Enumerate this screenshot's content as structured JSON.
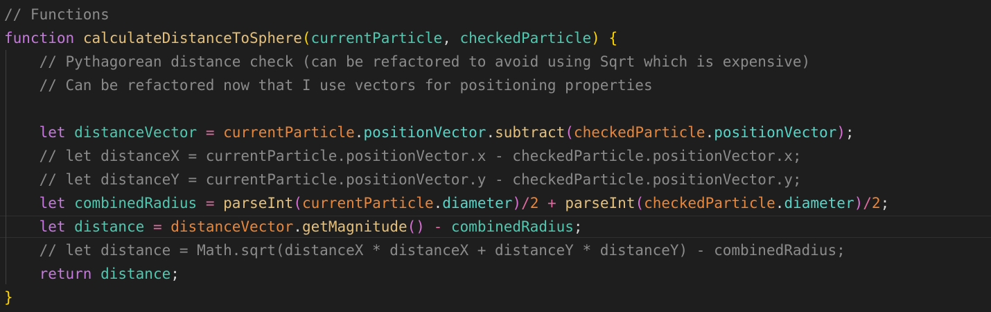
{
  "editor": {
    "lines": [
      {
        "tokens": [
          {
            "t": "// Functions",
            "c": "comment"
          }
        ]
      },
      {
        "tokens": [
          {
            "t": "function",
            "c": "kw"
          },
          {
            "t": " ",
            "c": "op"
          },
          {
            "t": "calculateDistanceToSphere",
            "c": "fn-name"
          },
          {
            "t": "(",
            "c": "paren-y"
          },
          {
            "t": "currentParticle",
            "c": "var"
          },
          {
            "t": ", ",
            "c": "op"
          },
          {
            "t": "checkedParticle",
            "c": "var"
          },
          {
            "t": ")",
            "c": "paren-y"
          },
          {
            "t": " ",
            "c": "op"
          },
          {
            "t": "{",
            "c": "brace"
          }
        ]
      },
      {
        "tokens": [
          {
            "t": "    // Pythagorean distance check (can be refactored to avoid using Sqrt which is expensive)",
            "c": "comment"
          }
        ]
      },
      {
        "tokens": [
          {
            "t": "    // Can be refactored now that I use vectors for positioning properties",
            "c": "comment"
          }
        ]
      },
      {
        "tokens": [
          {
            "t": "",
            "c": "op"
          }
        ]
      },
      {
        "tokens": [
          {
            "t": "    ",
            "c": "op"
          },
          {
            "t": "let",
            "c": "kw"
          },
          {
            "t": " ",
            "c": "op"
          },
          {
            "t": "distanceVector",
            "c": "var"
          },
          {
            "t": " = ",
            "c": "opm"
          },
          {
            "t": "currentParticle",
            "c": "obj"
          },
          {
            "t": ".",
            "c": "op"
          },
          {
            "t": "positionVector",
            "c": "prop"
          },
          {
            "t": ".",
            "c": "op"
          },
          {
            "t": "subtract",
            "c": "fn"
          },
          {
            "t": "(",
            "c": "paren-p"
          },
          {
            "t": "checkedParticle",
            "c": "obj"
          },
          {
            "t": ".",
            "c": "op"
          },
          {
            "t": "positionVector",
            "c": "prop"
          },
          {
            "t": ")",
            "c": "paren-p"
          },
          {
            "t": ";",
            "c": "op"
          }
        ]
      },
      {
        "tokens": [
          {
            "t": "    // let distanceX = currentParticle.positionVector.x - checkedParticle.positionVector.x;",
            "c": "comment"
          }
        ]
      },
      {
        "tokens": [
          {
            "t": "    // let distanceY = currentParticle.positionVector.y - checkedParticle.positionVector.y;",
            "c": "comment"
          }
        ]
      },
      {
        "tokens": [
          {
            "t": "    ",
            "c": "op"
          },
          {
            "t": "let",
            "c": "kw"
          },
          {
            "t": " ",
            "c": "op"
          },
          {
            "t": "combinedRadius",
            "c": "var"
          },
          {
            "t": " = ",
            "c": "opm"
          },
          {
            "t": "parseInt",
            "c": "fn"
          },
          {
            "t": "(",
            "c": "paren-p"
          },
          {
            "t": "currentParticle",
            "c": "obj"
          },
          {
            "t": ".",
            "c": "op"
          },
          {
            "t": "diameter",
            "c": "prop"
          },
          {
            "t": ")",
            "c": "paren-p"
          },
          {
            "t": "/",
            "c": "opm"
          },
          {
            "t": "2",
            "c": "num"
          },
          {
            "t": " + ",
            "c": "opm"
          },
          {
            "t": "parseInt",
            "c": "fn"
          },
          {
            "t": "(",
            "c": "paren-p"
          },
          {
            "t": "checkedParticle",
            "c": "obj"
          },
          {
            "t": ".",
            "c": "op"
          },
          {
            "t": "diameter",
            "c": "prop"
          },
          {
            "t": ")",
            "c": "paren-p"
          },
          {
            "t": "/",
            "c": "opm"
          },
          {
            "t": "2",
            "c": "num"
          },
          {
            "t": ";",
            "c": "op"
          }
        ]
      },
      {
        "tokens": [
          {
            "t": "    ",
            "c": "op"
          },
          {
            "t": "let",
            "c": "kw"
          },
          {
            "t": " ",
            "c": "op"
          },
          {
            "t": "distance",
            "c": "var"
          },
          {
            "t": " = ",
            "c": "opm"
          },
          {
            "t": "distanceVector",
            "c": "obj"
          },
          {
            "t": ".",
            "c": "op"
          },
          {
            "t": "getMagnitude",
            "c": "fn"
          },
          {
            "t": "()",
            "c": "paren-p"
          },
          {
            "t": " - ",
            "c": "opm"
          },
          {
            "t": "combinedRadius",
            "c": "var"
          },
          {
            "t": ";",
            "c": "op"
          }
        ]
      },
      {
        "tokens": [
          {
            "t": "    // let distance = Math.sqrt(distanceX * distanceX + distanceY * distanceY) - combinedRadius;",
            "c": "comment"
          }
        ]
      },
      {
        "tokens": [
          {
            "t": "    ",
            "c": "op"
          },
          {
            "t": "return",
            "c": "kw"
          },
          {
            "t": " ",
            "c": "op"
          },
          {
            "t": "distance",
            "c": "var"
          },
          {
            "t": ";",
            "c": "op"
          }
        ]
      },
      {
        "tokens": [
          {
            "t": "}",
            "c": "brace"
          }
        ]
      }
    ]
  }
}
